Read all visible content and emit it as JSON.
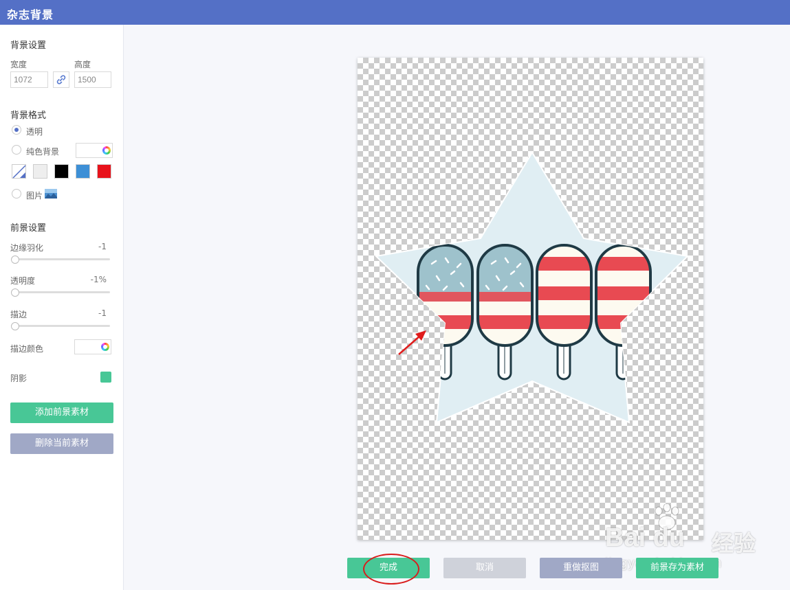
{
  "window": {
    "title": "杂志背景"
  },
  "background_settings": {
    "title": "背景设置",
    "width_label": "宽度",
    "height_label": "高度",
    "width_value": "1072",
    "height_value": "1500"
  },
  "background_format": {
    "title": "背景格式",
    "transparent_label": "透明",
    "solid_label": "纯色背景",
    "image_label": "图片",
    "selected": "透明",
    "swatches": [
      "#eeeeee",
      "#000000",
      "#3d8fd6",
      "#e8121b"
    ]
  },
  "foreground_settings": {
    "title": "前景设置",
    "feather_label": "边缘羽化",
    "feather_value": "-1",
    "opacity_label": "透明度",
    "opacity_value": "-1%",
    "stroke_label": "描边",
    "stroke_value": "-1",
    "stroke_color_label": "描边颜色",
    "shadow_label": "阴影",
    "shadow_color": "#48c796"
  },
  "side_buttons": {
    "add_label": "添加前景素材",
    "delete_label": "删除当前素材"
  },
  "bottom_buttons": {
    "done_label": "完成",
    "cancel_label": "取消",
    "redo_label": "重做抠图",
    "save_label": "前景存为素材"
  },
  "watermark": {
    "brand": "Bai du",
    "brand_cn": "经验",
    "url": "jingyan.baidu.com"
  },
  "colors": {
    "accent": "#5470c6",
    "primary_button": "#48c796",
    "secondary_button": "#a0a8c6",
    "annotation": "#e01b1b"
  }
}
